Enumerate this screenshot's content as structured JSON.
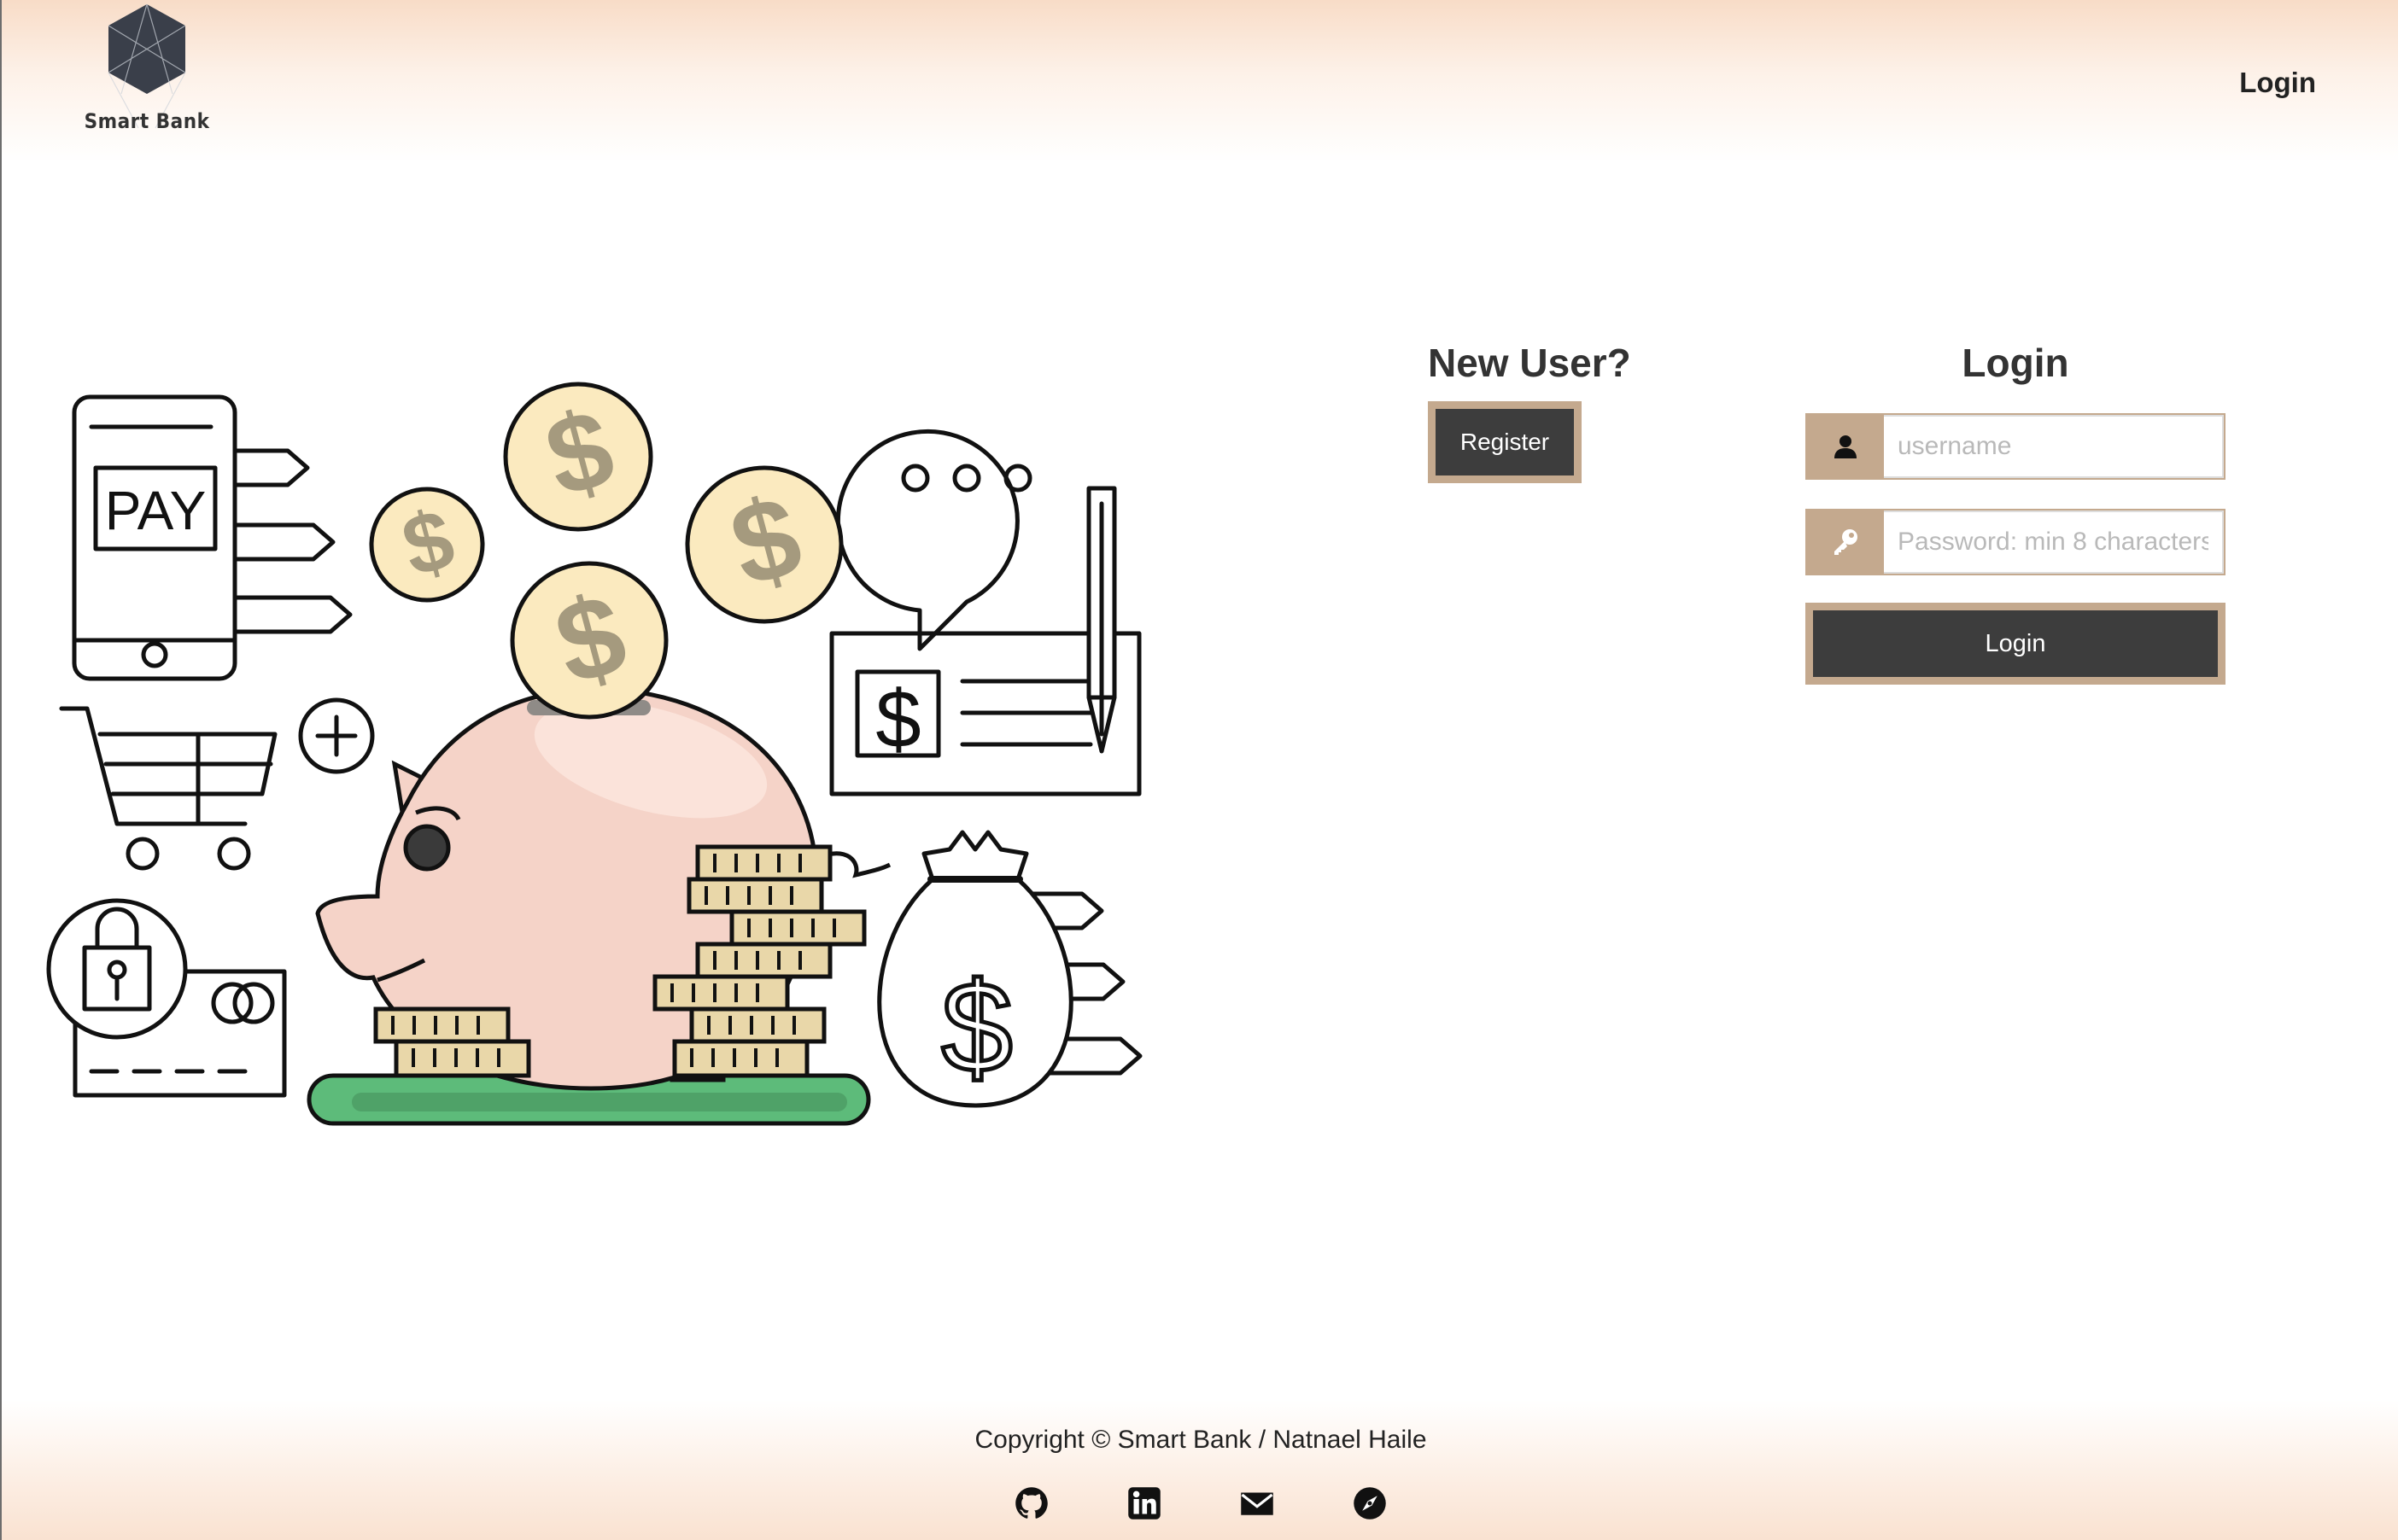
{
  "header": {
    "brand": "Smart Bank",
    "nav_login": "Login"
  },
  "register_panel": {
    "title": "New User?",
    "register_label": "Register"
  },
  "login_panel": {
    "title": "Login",
    "username_placeholder": "username",
    "password_placeholder": "Password: min 8 characters",
    "submit_label": "Login"
  },
  "footer": {
    "copyright": "Copyright © Smart Bank / Natnael Haile",
    "social_icons": [
      "github-icon",
      "linkedin-icon",
      "mail-icon",
      "compass-icon"
    ]
  },
  "colors": {
    "accent": "#c4a98e",
    "button_dark": "#3d3d3d",
    "header_peach": "#f8dcc7",
    "piggy": "#f5d3c8",
    "coin": "#fbeabf",
    "grass": "#5dbb7a"
  }
}
